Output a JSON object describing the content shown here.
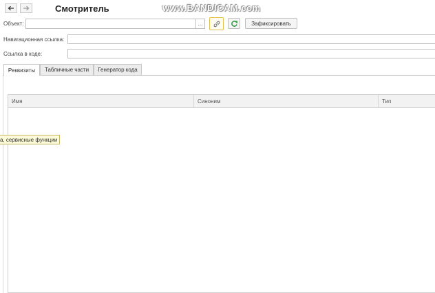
{
  "window": {
    "title": "Смотритель"
  },
  "watermark": "www.BANDICAM.com",
  "nav": {
    "back_icon": "arrow-left-icon",
    "forward_icon": "arrow-right-icon"
  },
  "object_row": {
    "label": "Объект:",
    "value": "",
    "select_button": "...",
    "fix_button": "Зафиксировать"
  },
  "nav_link": {
    "label": "Навигационная ссылка:",
    "value": ""
  },
  "code_link": {
    "label": "Ссылка в коде:",
    "value": ""
  },
  "tabs": [
    {
      "label": "Реквизиты",
      "active": true
    },
    {
      "label": "Табличные части",
      "active": false
    },
    {
      "label": "Генератор кода",
      "active": false
    }
  ],
  "table": {
    "columns": [
      "Имя",
      "Синоним",
      "Тип"
    ],
    "rows": []
  },
  "tooltip": {
    "text": "а, сервисные функции"
  },
  "colors": {
    "refresh_green": "#2e9a3a",
    "link_highlight": "#e8c84a"
  }
}
